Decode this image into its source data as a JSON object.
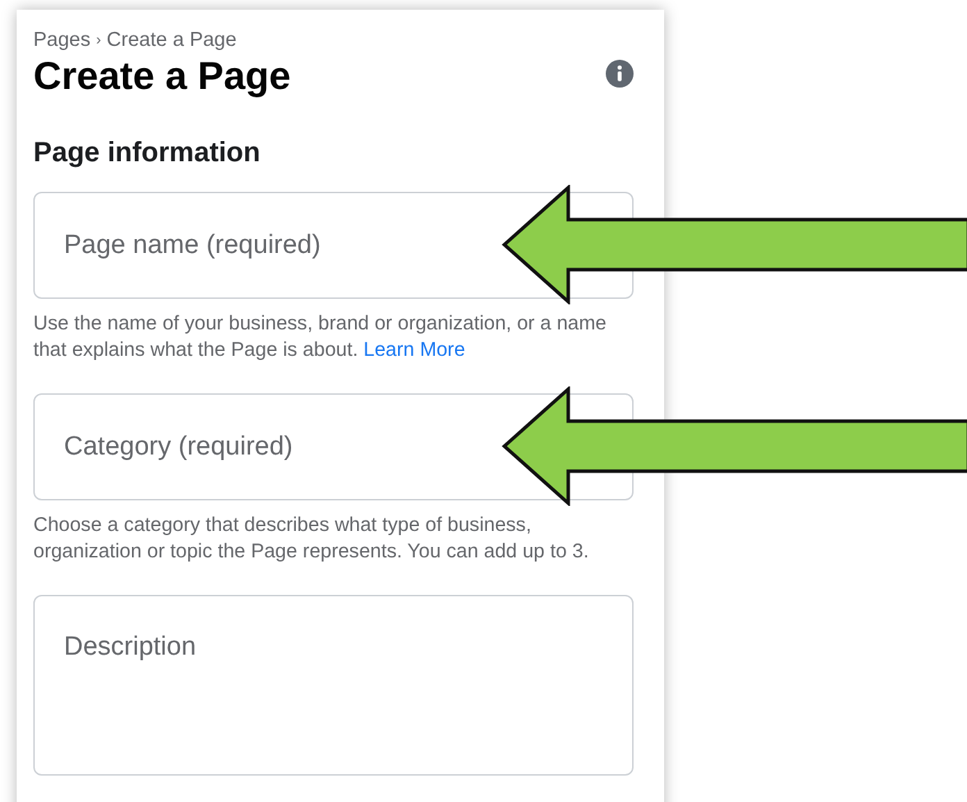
{
  "breadcrumb": {
    "items": [
      "Pages",
      "Create a Page"
    ],
    "separator": "›"
  },
  "title": "Create a Page",
  "section": "Page information",
  "fields": [
    {
      "placeholder": "Page name (required)",
      "kind": "line",
      "hint": "Use the name of your business, brand or organization, or a name that explains what the Page is about.",
      "link": "Learn More",
      "arrow": true
    },
    {
      "placeholder": "Category (required)",
      "kind": "line",
      "hint": "Choose a category that describes what type of business, organization or topic the Page represents. You can add up to 3.",
      "arrow": true
    },
    {
      "placeholder": "Description",
      "kind": "area",
      "arrow": false
    }
  ]
}
